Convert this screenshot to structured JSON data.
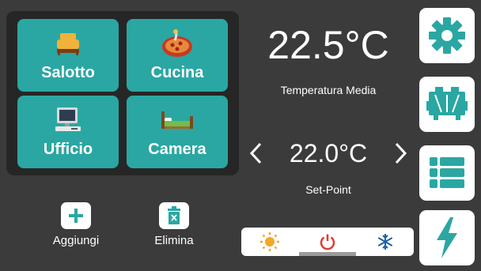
{
  "rooms": [
    {
      "label": "Salotto",
      "icon": "sofa-icon"
    },
    {
      "label": "Cucina",
      "icon": "pizza-icon"
    },
    {
      "label": "Ufficio",
      "icon": "computer-icon"
    },
    {
      "label": "Camera",
      "icon": "bed-icon"
    }
  ],
  "actions": {
    "add_label": "Aggiungi",
    "delete_label": "Elimina"
  },
  "temperature": {
    "average": "22.5°C",
    "average_caption": "Temperatura Media",
    "setpoint": "22.0°C",
    "setpoint_caption": "Set-Point"
  },
  "modes": [
    {
      "name": "heat",
      "icon": "sun-icon"
    },
    {
      "name": "off",
      "icon": "power-icon",
      "active": true
    },
    {
      "name": "cool",
      "icon": "snowflake-icon"
    }
  ],
  "sidebar": [
    {
      "icon": "gear-icon"
    },
    {
      "icon": "unit-icon"
    },
    {
      "icon": "list-icon"
    },
    {
      "icon": "bolt-icon"
    }
  ],
  "colors": {
    "background": "#3b3b3b",
    "panel": "#262626",
    "accent": "#2aa7a3",
    "power_red": "#e53935",
    "sun": "#f5a623",
    "snow": "#1e5fa8"
  }
}
